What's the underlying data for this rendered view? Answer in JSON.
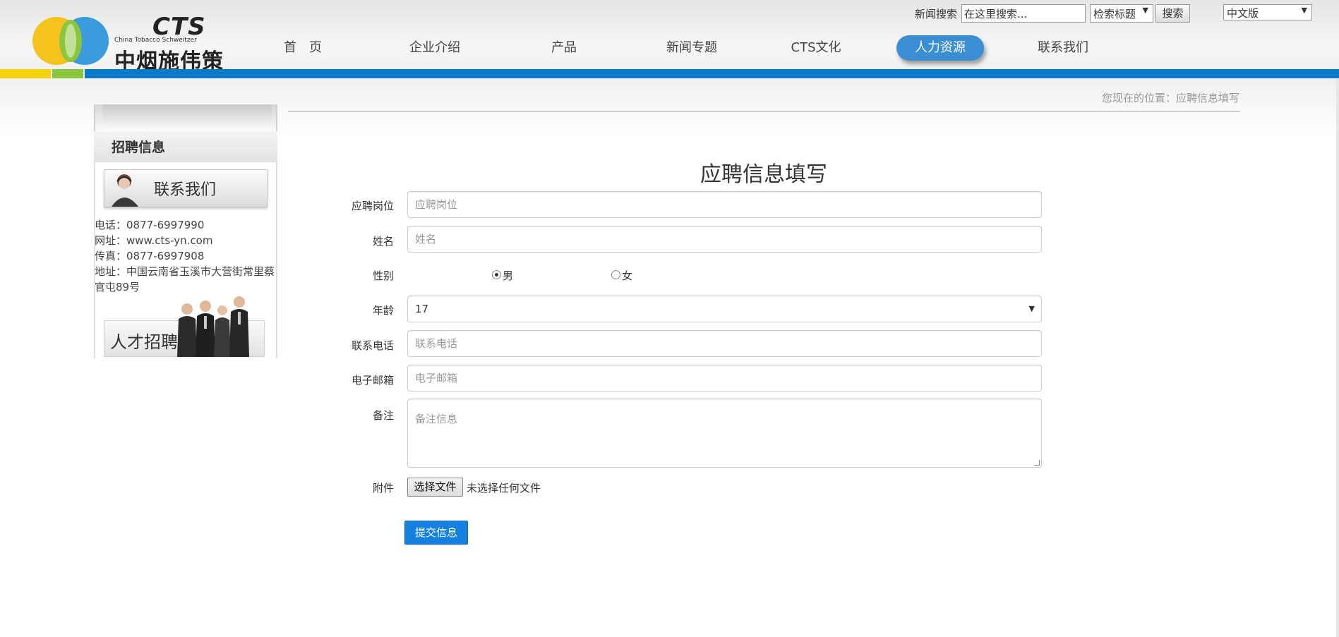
{
  "header": {
    "logo": {
      "brand": "CTS",
      "english_name": "China Tobacco Schweitzer",
      "chinese_name": "中烟施伟策"
    },
    "search": {
      "label": "新闻搜索",
      "placeholder": "在这里搜索...",
      "scope_selected": "检索标题",
      "button": "搜索"
    },
    "language": {
      "selected": "中文版"
    },
    "nav": [
      {
        "label": "首　页",
        "active": false
      },
      {
        "label": "企业介绍",
        "active": false
      },
      {
        "label": "产品",
        "active": false
      },
      {
        "label": "新闻专题",
        "active": false
      },
      {
        "label": "CTS文化",
        "active": false
      },
      {
        "label": "人力资源",
        "active": true
      },
      {
        "label": "联系我们",
        "active": false
      }
    ],
    "accent_colors": {
      "stripe_yellow": "#f5d20b",
      "stripe_green": "#8cc63f",
      "stripe_blue": "#0a79c8",
      "nav_active": "#3a8ed3"
    }
  },
  "sidebar": {
    "heading": "招聘信息",
    "contact_banner": "联系我们",
    "contact_info": [
      "电话：0877-6997990",
      "网址：www.cts-yn.com",
      "传真：0877-6997908",
      "地址：中国云南省玉溪市大营街常里蔡",
      "官屯89号"
    ],
    "talent_banner": "人才招聘"
  },
  "breadcrumb": "您现在的位置：应聘信息填写",
  "form": {
    "title": "应聘信息填写",
    "fields": {
      "position": {
        "label": "应聘岗位",
        "placeholder": "应聘岗位"
      },
      "name": {
        "label": "姓名",
        "placeholder": "姓名"
      },
      "gender": {
        "label": "性别",
        "options": [
          "男",
          "女"
        ],
        "selected": "男"
      },
      "age": {
        "label": "年龄",
        "value": "17"
      },
      "phone": {
        "label": "联系电话",
        "placeholder": "联系电话"
      },
      "email": {
        "label": "电子邮箱",
        "placeholder": "电子邮箱"
      },
      "remarks": {
        "label": "备注",
        "placeholder": "备注信息"
      },
      "attachment": {
        "label": "附件",
        "button": "选择文件",
        "status": "未选择任何文件"
      }
    },
    "submit": "提交信息",
    "submit_color": "#1480e0"
  }
}
